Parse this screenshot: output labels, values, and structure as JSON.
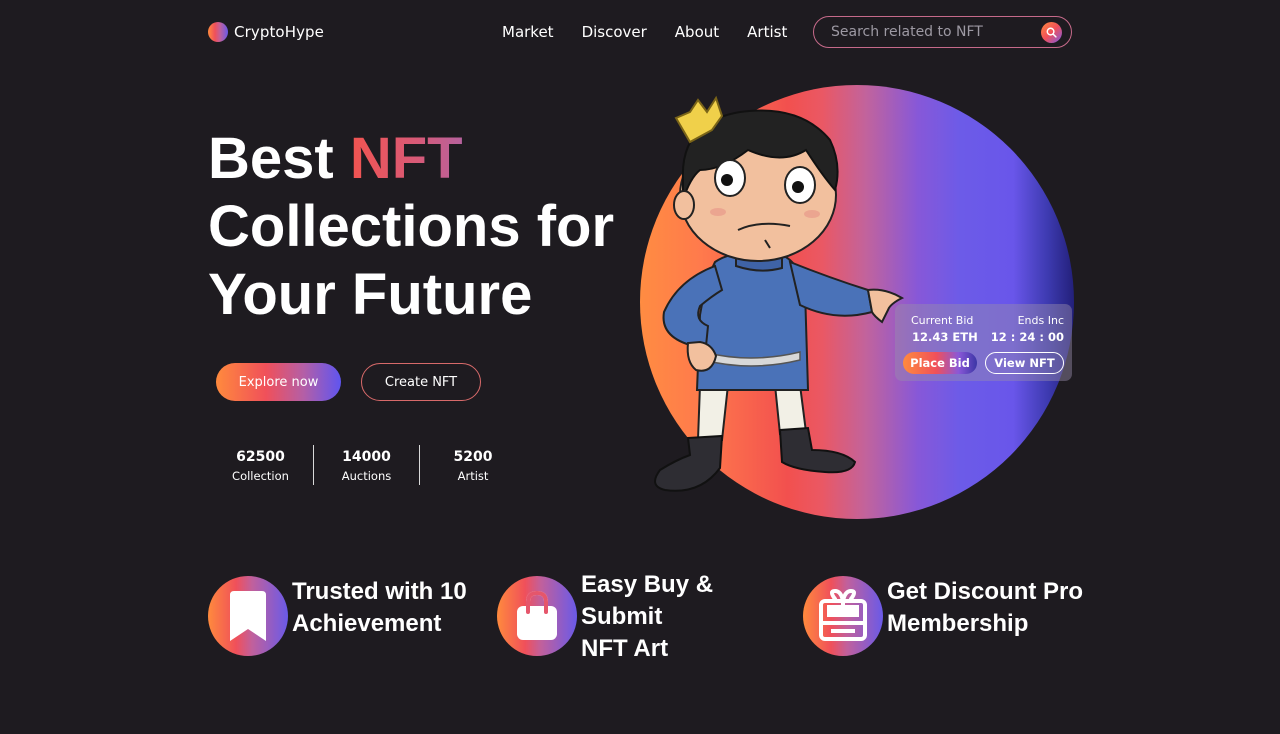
{
  "brand": {
    "name": "CryptoHype"
  },
  "nav": {
    "items": [
      {
        "label": "Market"
      },
      {
        "label": "Discover"
      },
      {
        "label": "About"
      },
      {
        "label": "Artist"
      }
    ]
  },
  "search": {
    "placeholder": "Search related to NFT",
    "icon": "search-icon"
  },
  "hero": {
    "headline_part1": "Best ",
    "headline_accent": "NFT",
    "headline_line2": "Collections for",
    "headline_line3": "Your Future",
    "explore_label": "Explore now",
    "create_label": "Create NFT",
    "stats": [
      {
        "value": "62500",
        "label": "Collection"
      },
      {
        "value": "14000",
        "label": "Auctions"
      },
      {
        "value": "5200",
        "label": "Artist"
      }
    ]
  },
  "bid_card": {
    "current_bid_label": "Current Bid",
    "current_bid_value": "12.43 ETH",
    "ends_label": "Ends Inc",
    "ends_value": "12 : 24 : 00",
    "place_bid_label": "Place Bid",
    "view_nft_label": "View NFT"
  },
  "features": [
    {
      "icon": "bookmark-icon",
      "lines": [
        "Trusted with 10",
        "Achievement"
      ]
    },
    {
      "icon": "shopping-bag-icon",
      "lines": [
        "Easy Buy &",
        "Submit",
        "NFT Art"
      ]
    },
    {
      "icon": "gift-card-icon",
      "lines": [
        "Get Discount Pro",
        "Membership"
      ]
    }
  ],
  "colors": {
    "background": "#1e1b20",
    "accent_orange": "#ff8a3d",
    "accent_red": "#f0505a",
    "accent_pink": "#c1609c",
    "accent_purple": "#6a5ae8"
  }
}
